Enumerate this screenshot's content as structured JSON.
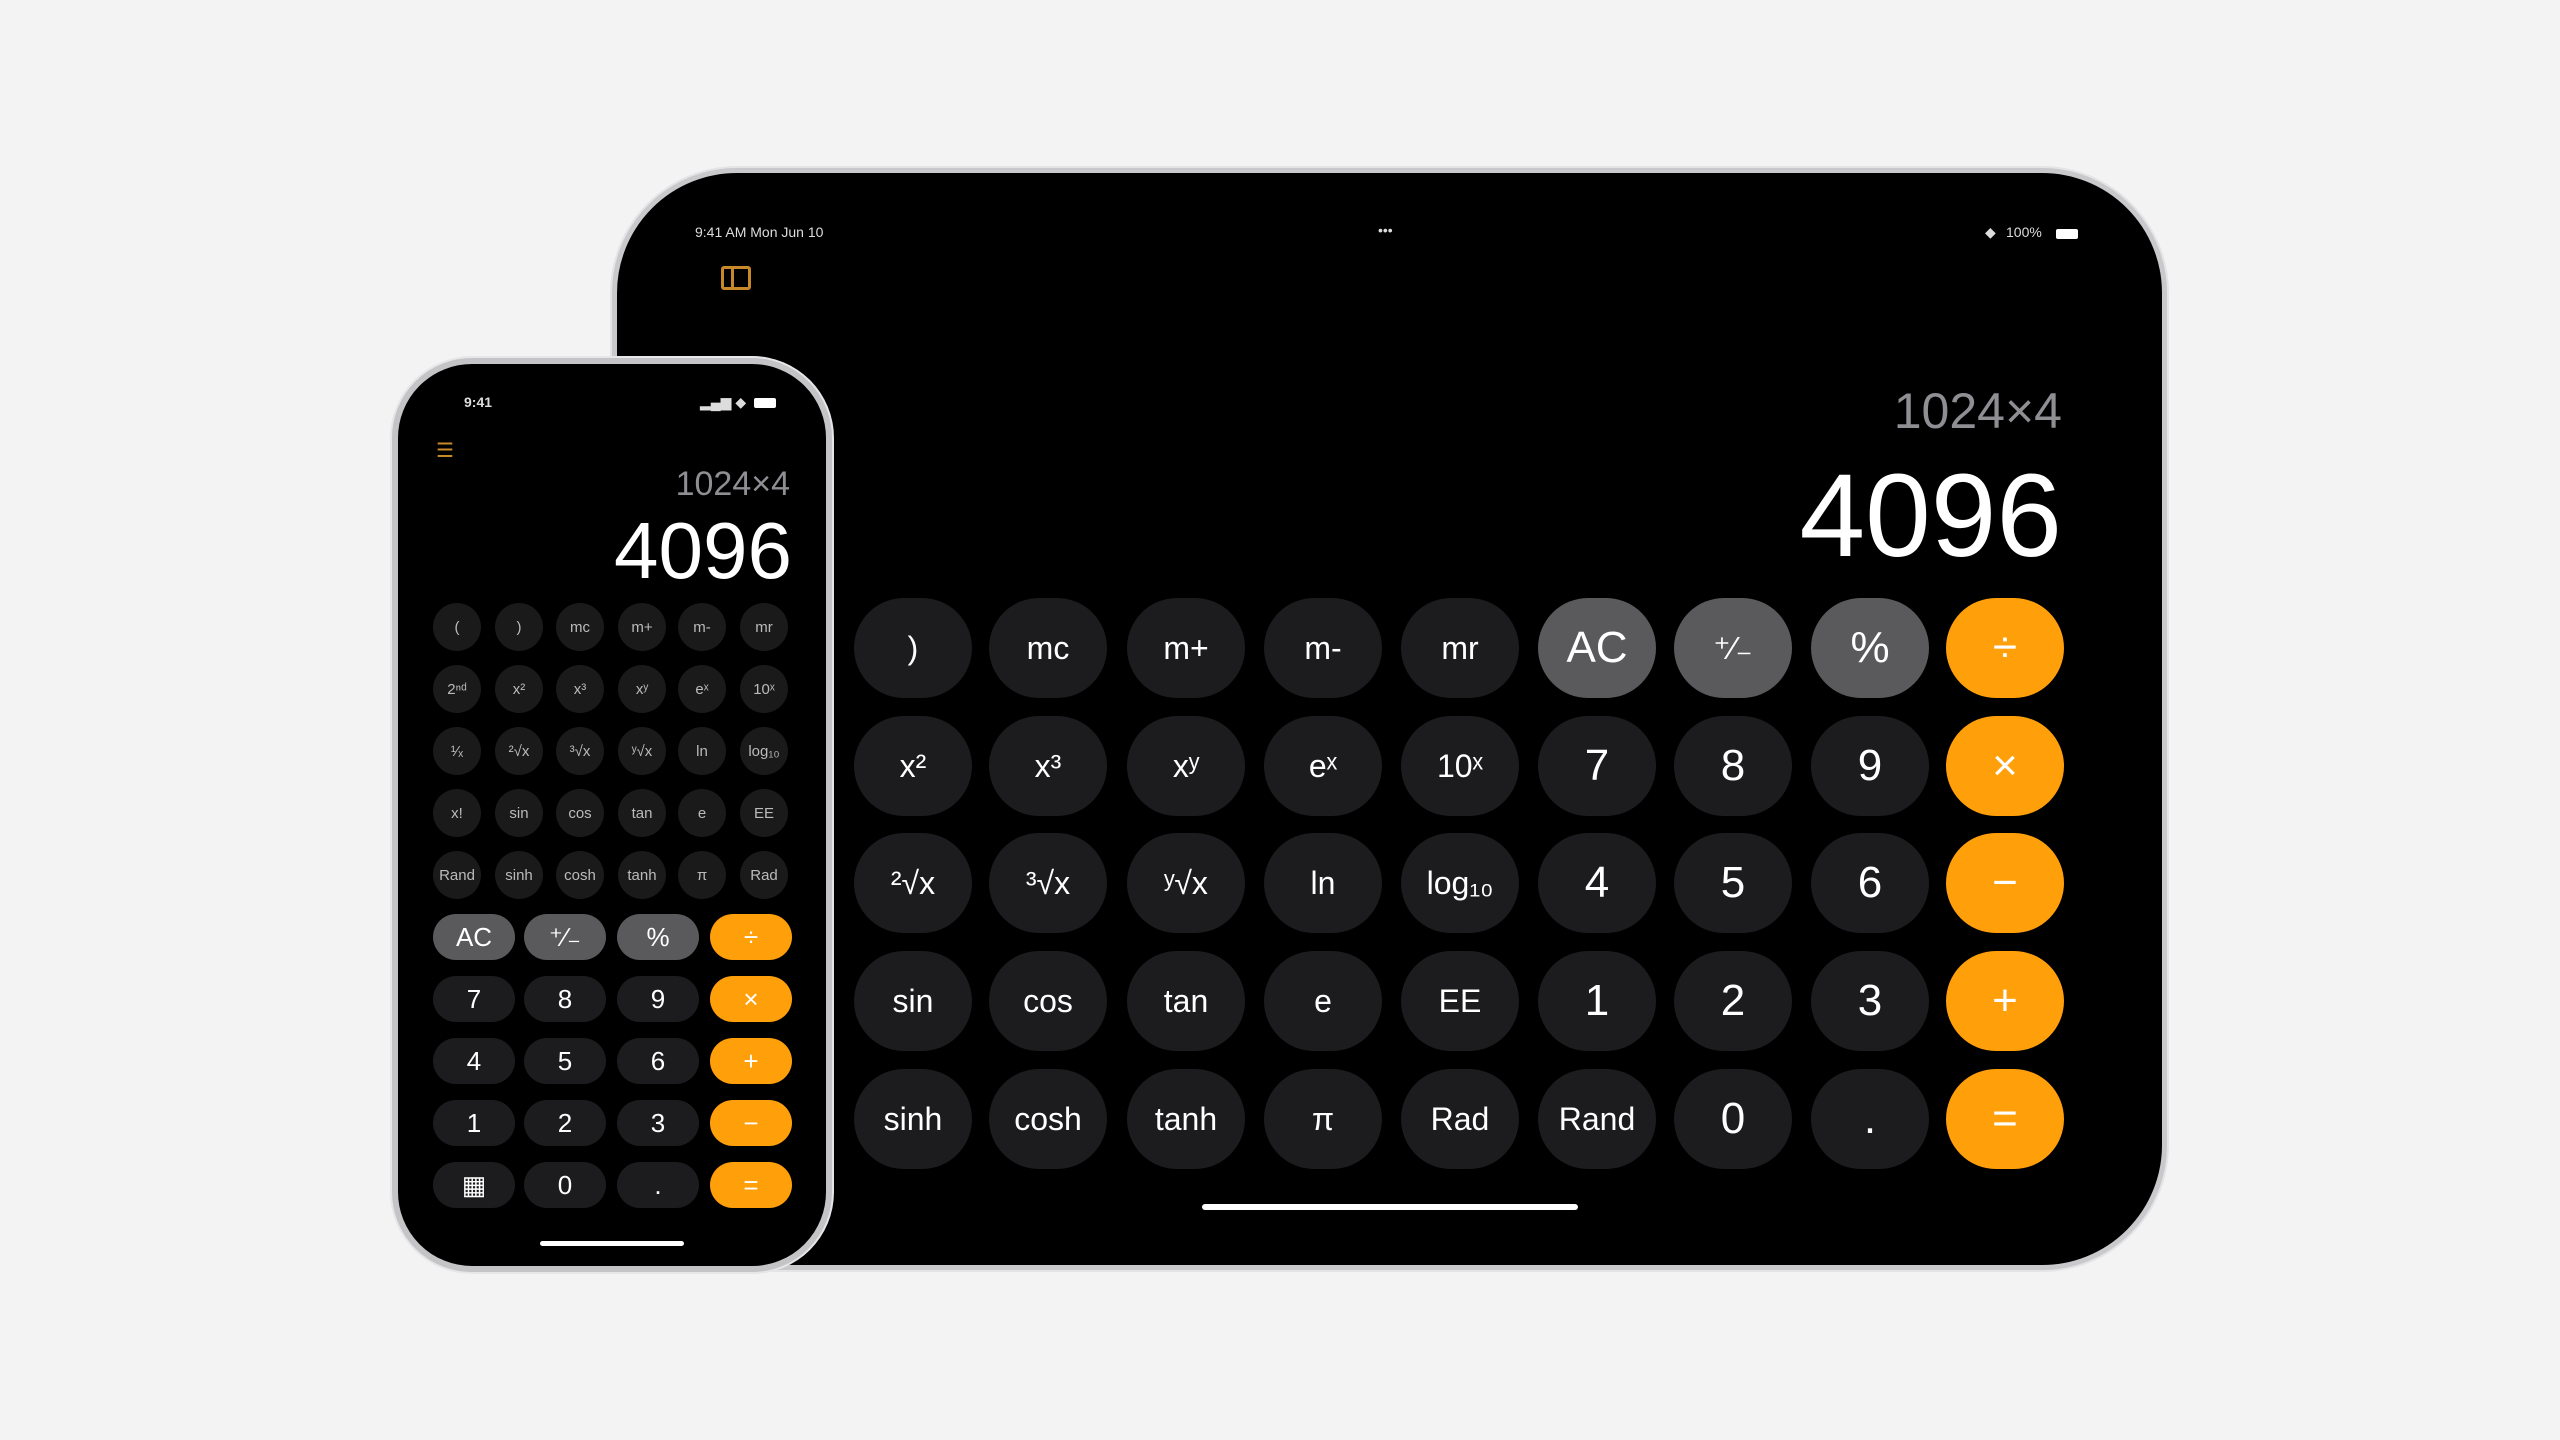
{
  "colors": {
    "operator": "#ff9f0a",
    "function": "#5a5a5c",
    "digit": "#1c1c1e",
    "background": "#f3f3f4"
  },
  "ipad": {
    "status_left": "9:41 AM  Mon Jun 10",
    "status_center": "•••",
    "status_right": "100%",
    "sidebar_icon": "sidebar-icon",
    "expression": "1024×4",
    "result": "4096",
    "rows": [
      [
        {
          "l": ")",
          "t": "d"
        },
        {
          "l": "mc",
          "t": "d"
        },
        {
          "l": "m+",
          "t": "d"
        },
        {
          "l": "m-",
          "t": "d"
        },
        {
          "l": "mr",
          "t": "d"
        },
        {
          "l": "AC",
          "t": "f"
        },
        {
          "l": "⁺∕₋",
          "t": "f"
        },
        {
          "l": "%",
          "t": "f"
        },
        {
          "l": "÷",
          "t": "o"
        }
      ],
      [
        {
          "l": "x²",
          "t": "d"
        },
        {
          "l": "x³",
          "t": "d"
        },
        {
          "l": "xʸ",
          "t": "d"
        },
        {
          "l": "eˣ",
          "t": "d"
        },
        {
          "l": "10ˣ",
          "t": "d"
        },
        {
          "l": "7",
          "t": "d"
        },
        {
          "l": "8",
          "t": "d"
        },
        {
          "l": "9",
          "t": "d"
        },
        {
          "l": "×",
          "t": "o"
        }
      ],
      [
        {
          "l": "²√x",
          "t": "d"
        },
        {
          "l": "³√x",
          "t": "d"
        },
        {
          "l": "ʸ√x",
          "t": "d"
        },
        {
          "l": "ln",
          "t": "d"
        },
        {
          "l": "log₁₀",
          "t": "d"
        },
        {
          "l": "4",
          "t": "d"
        },
        {
          "l": "5",
          "t": "d"
        },
        {
          "l": "6",
          "t": "d"
        },
        {
          "l": "−",
          "t": "o"
        }
      ],
      [
        {
          "l": "sin",
          "t": "d"
        },
        {
          "l": "cos",
          "t": "d"
        },
        {
          "l": "tan",
          "t": "d"
        },
        {
          "l": "e",
          "t": "d"
        },
        {
          "l": "EE",
          "t": "d"
        },
        {
          "l": "1",
          "t": "d"
        },
        {
          "l": "2",
          "t": "d"
        },
        {
          "l": "3",
          "t": "d"
        },
        {
          "l": "+",
          "t": "o"
        }
      ],
      [
        {
          "l": "sinh",
          "t": "d"
        },
        {
          "l": "cosh",
          "t": "d"
        },
        {
          "l": "tanh",
          "t": "d"
        },
        {
          "l": "π",
          "t": "d"
        },
        {
          "l": "Rad",
          "t": "d"
        },
        {
          "l": "Rand",
          "t": "d"
        },
        {
          "l": "0",
          "t": "d"
        },
        {
          "l": ".",
          "t": "d"
        },
        {
          "l": "=",
          "t": "o"
        }
      ]
    ]
  },
  "iphone": {
    "time": "9:41",
    "list_icon": "list-icon",
    "expression": "1024×4",
    "result": "4096",
    "sci_rows": [
      [
        "(",
        ")",
        "mc",
        "m+",
        "m-",
        "mr"
      ],
      [
        "2ⁿᵈ",
        "x²",
        "x³",
        "xʸ",
        "eˣ",
        "10ˣ"
      ],
      [
        "¹⁄ₓ",
        "²√x",
        "³√x",
        "ʸ√x",
        "ln",
        "log₁₀"
      ],
      [
        "x!",
        "sin",
        "cos",
        "tan",
        "e",
        "EE"
      ],
      [
        "Rand",
        "sinh",
        "cosh",
        "tanh",
        "π",
        "Rad"
      ]
    ],
    "rows": [
      [
        {
          "l": "AC",
          "t": "f"
        },
        {
          "l": "⁺∕₋",
          "t": "f"
        },
        {
          "l": "%",
          "t": "f"
        },
        {
          "l": "÷",
          "t": "o"
        }
      ],
      [
        {
          "l": "7",
          "t": "d"
        },
        {
          "l": "8",
          "t": "d"
        },
        {
          "l": "9",
          "t": "d"
        },
        {
          "l": "×",
          "t": "o"
        }
      ],
      [
        {
          "l": "4",
          "t": "d"
        },
        {
          "l": "5",
          "t": "d"
        },
        {
          "l": "6",
          "t": "d"
        },
        {
          "l": "+",
          "t": "o"
        }
      ],
      [
        {
          "l": "1",
          "t": "d"
        },
        {
          "l": "2",
          "t": "d"
        },
        {
          "l": "3",
          "t": "d"
        },
        {
          "l": "−",
          "t": "o"
        }
      ],
      [
        {
          "l": "▦",
          "t": "d"
        },
        {
          "l": "0",
          "t": "d"
        },
        {
          "l": ".",
          "t": "d"
        },
        {
          "l": "=",
          "t": "o"
        }
      ]
    ]
  }
}
